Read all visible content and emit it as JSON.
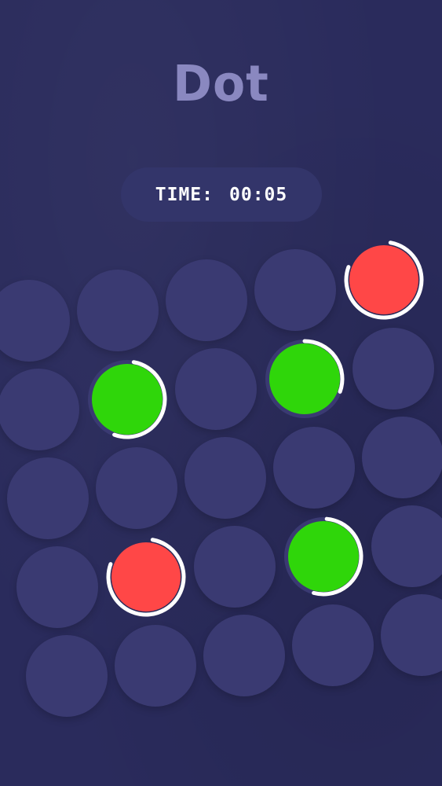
{
  "game": {
    "title": "Dot",
    "timer": {
      "label": "TIME:",
      "value": "00:05"
    }
  },
  "colors": {
    "background": "#2a2b5c",
    "slot": "#3a3a72",
    "green_dot": "#2fd60a",
    "red_dot": "#ff4747",
    "ring": "#ffffff",
    "title": "#8a88c0"
  },
  "grid": {
    "rows": 5,
    "columns": 5
  },
  "active_dots": [
    {
      "row": 0,
      "col": 4,
      "color": "red"
    },
    {
      "row": 1,
      "col": 1,
      "color": "green"
    },
    {
      "row": 1,
      "col": 3,
      "color": "green"
    },
    {
      "row": 3,
      "col": 1,
      "color": "red"
    },
    {
      "row": 3,
      "col": 3,
      "color": "green"
    }
  ]
}
